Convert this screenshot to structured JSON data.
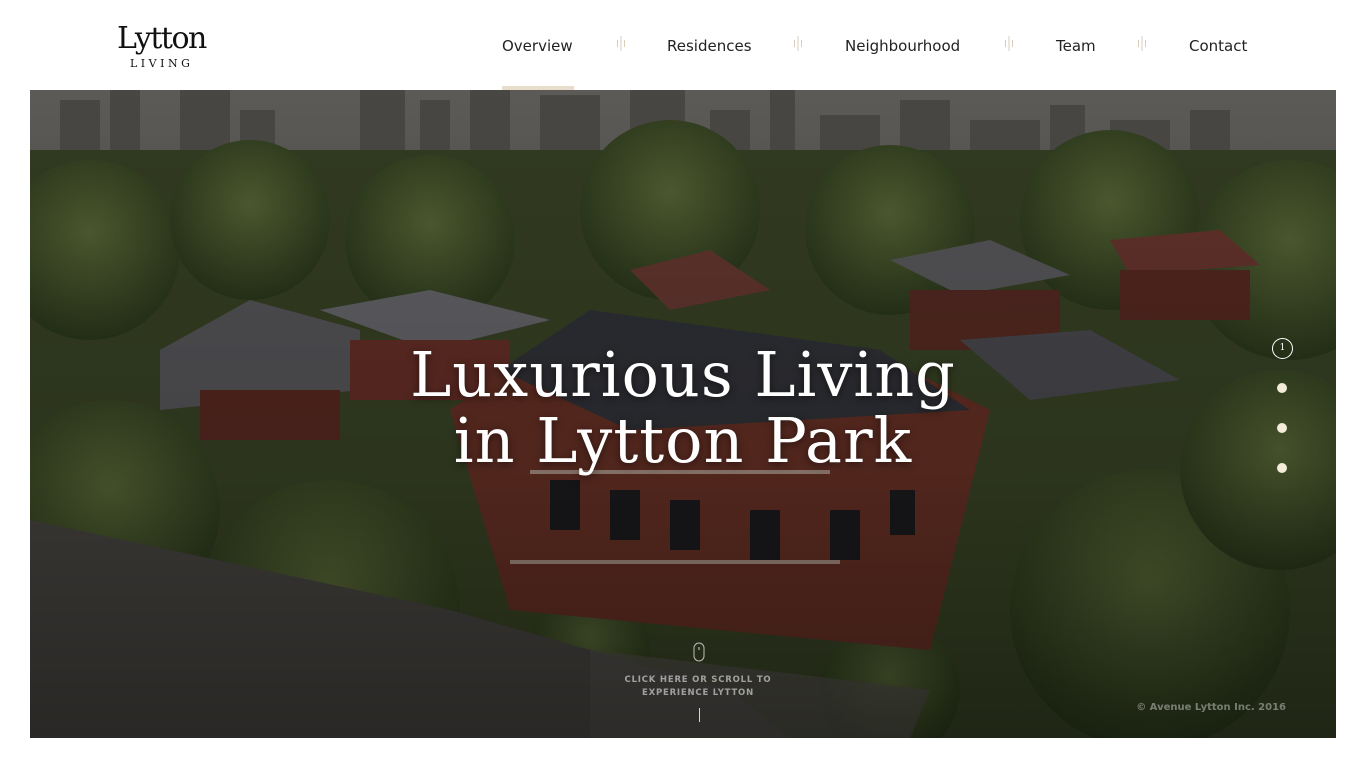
{
  "logo": {
    "name": "Lytton",
    "tagline": "LIVING"
  },
  "nav": {
    "items": [
      {
        "label": "Overview",
        "active": true
      },
      {
        "label": "Residences",
        "active": false
      },
      {
        "label": "Neighbourhood",
        "active": false
      },
      {
        "label": "Team",
        "active": false
      },
      {
        "label": "Contact",
        "active": false
      }
    ],
    "separator_icon": "tuning-fork-divider-icon"
  },
  "hero": {
    "title_line1": "Luxurious Living",
    "title_line2": "in Lytton Park",
    "background": "aerial-photo-townhouses-trees-city-skyline"
  },
  "pager": {
    "current_label": "1",
    "total": 4,
    "current_index": 1
  },
  "scroll_cue": {
    "text": "CLICK HERE OR SCROLL TO EXPERIENCE LYTTON",
    "icon": "mouse-icon"
  },
  "footer": {
    "copyright": "© Avenue Lytton Inc. 2016"
  },
  "colors": {
    "accent_underline": "#e8dccb",
    "pager_dot": "#f4ecd9",
    "nav_text": "#222222"
  }
}
